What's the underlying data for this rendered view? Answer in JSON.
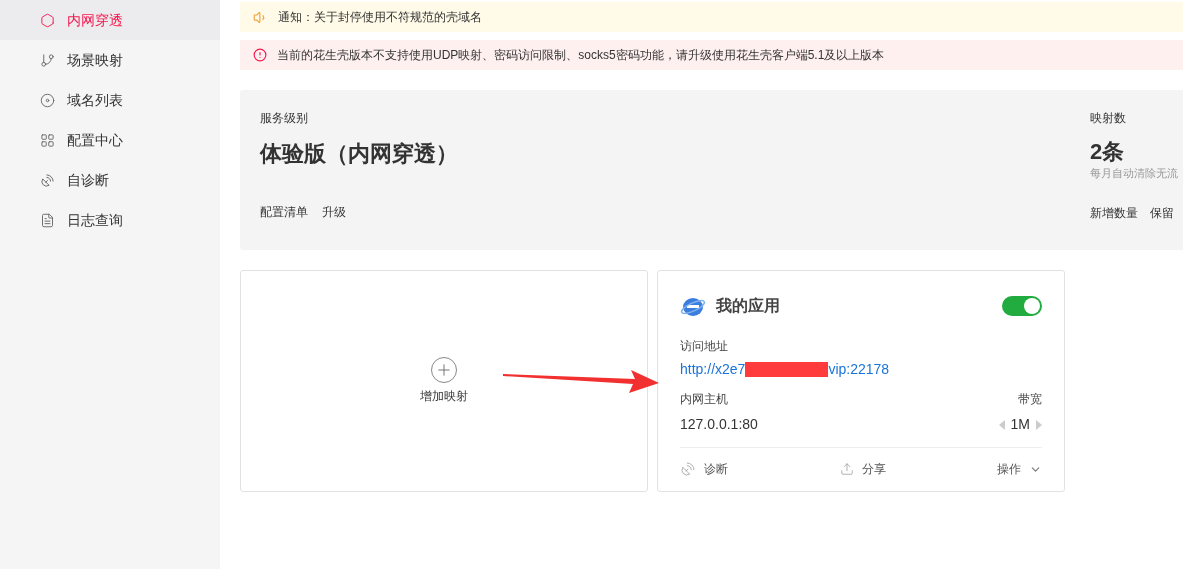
{
  "sidebar": {
    "items": [
      {
        "label": "内网穿透",
        "kind": "tunnel",
        "selected": true
      },
      {
        "label": "场景映射",
        "kind": "branch",
        "selected": false
      },
      {
        "label": "域名列表",
        "kind": "domain",
        "selected": false
      },
      {
        "label": "配置中心",
        "kind": "grid",
        "selected": false
      },
      {
        "label": "自诊断",
        "kind": "dish",
        "selected": false
      },
      {
        "label": "日志查询",
        "kind": "log",
        "selected": false
      }
    ]
  },
  "notices": [
    {
      "kind": "info",
      "text": "通知：关于封停使用不符规范的壳域名"
    },
    {
      "kind": "warning",
      "text": "当前的花生壳版本不支持使用UDP映射、密码访问限制、socks5密码功能，请升级使用花生壳客户端5.1及以上版本"
    }
  ],
  "service": {
    "label": "服务级别",
    "plan": "体验版（内网穿透）",
    "links": [
      "配置清单",
      "升级"
    ]
  },
  "mappings_summary": {
    "label": "映射数",
    "count": "2条",
    "note": "每月自动清除无流",
    "links": [
      "新增数量",
      "保留"
    ]
  },
  "add_card": {
    "label": "增加映射"
  },
  "app_card": {
    "name": "我的应用",
    "enabled": true,
    "address_label": "访问地址",
    "address_start": "http://x2e7",
    "address_end": "vip:22178",
    "host_label": "内网主机",
    "host": "127.0.0.1:80",
    "bandwidth_label": "带宽",
    "bandwidth": "1M",
    "actions": [
      {
        "kind": "diagnose",
        "label": "诊断"
      },
      {
        "kind": "share",
        "label": "分享"
      },
      {
        "kind": "menu",
        "label": "操作"
      }
    ]
  }
}
